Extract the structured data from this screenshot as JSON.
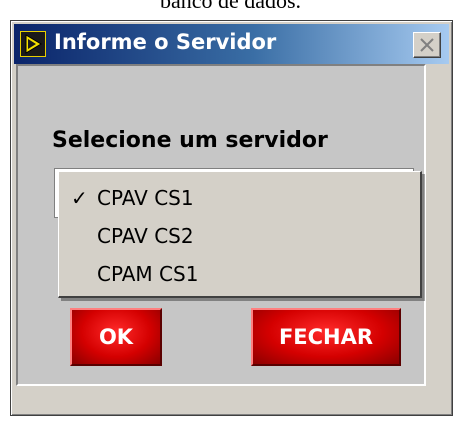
{
  "page_caption": "banco de dados.",
  "window": {
    "title": "Informe o Servidor",
    "icon": "labview-run-icon",
    "close_icon": "close-icon"
  },
  "form": {
    "select_label": "Selecione um servidor",
    "selected_value": "CPAV CS1",
    "options": [
      {
        "label": "CPAV CS1",
        "checked": true
      },
      {
        "label": "CPAV CS2",
        "checked": false
      },
      {
        "label": "CPAM CS1",
        "checked": false
      }
    ],
    "check_mark": "✓"
  },
  "buttons": {
    "ok_label": "OK",
    "close_label": "FECHAR"
  }
}
